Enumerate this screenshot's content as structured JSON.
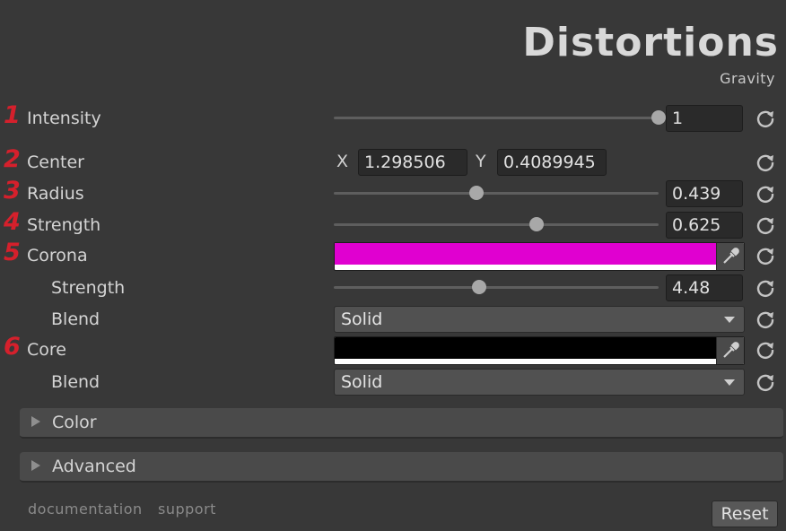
{
  "header": {
    "title": "Distortions",
    "subtitle": "Gravity"
  },
  "properties": {
    "intensity": {
      "number": "1",
      "label": "Intensity",
      "value": "1",
      "slider_fraction": 1.0
    },
    "center": {
      "number": "2",
      "label": "Center",
      "x_label": "X",
      "x_value": "1.298506",
      "y_label": "Y",
      "y_value": "0.4089945"
    },
    "radius": {
      "number": "3",
      "label": "Radius",
      "value": "0.439",
      "slider_fraction": 0.439
    },
    "strength": {
      "number": "4",
      "label": "Strength",
      "value": "0.625",
      "slider_fraction": 0.625
    },
    "corona": {
      "number": "5",
      "label": "Corona",
      "color": "#e000d0",
      "strength": {
        "label": "Strength",
        "value": "4.48",
        "slider_fraction": 0.448
      },
      "blend": {
        "label": "Blend",
        "selected": "Solid"
      }
    },
    "core": {
      "number": "6",
      "label": "Core",
      "color": "#000000",
      "blend": {
        "label": "Blend",
        "selected": "Solid"
      }
    }
  },
  "foldouts": {
    "color": "Color",
    "advanced": "Advanced"
  },
  "footer": {
    "documentation": "documentation",
    "support": "support",
    "reset": "Reset"
  },
  "icons": {
    "reset": "refresh-icon",
    "picker": "eyedropper-icon",
    "fold": "triangle-right-icon"
  }
}
